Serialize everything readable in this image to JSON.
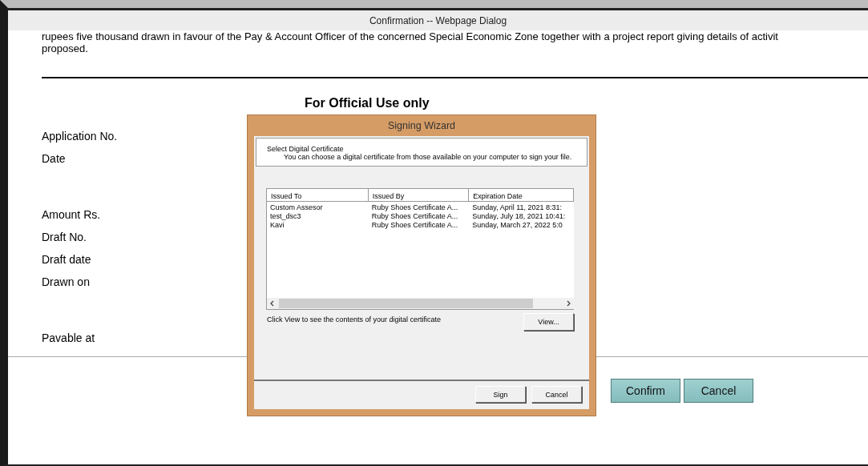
{
  "window": {
    "title": "Confirmation -- Webpage Dialog"
  },
  "page": {
    "paragraph_lines": [
      "rupees five thousand drawn in favour of the Pay & Account Officer of the concerned Special Economic Zone together with a project report giving details of activit",
      "proposed."
    ],
    "heading": "For Official Use only",
    "fields": [
      "Application No.",
      "Date",
      "Amount Rs.",
      "Draft No.",
      "Draft date",
      "Drawn on",
      "Pavable at"
    ],
    "buttons": [
      "Confirm",
      "Cancel"
    ]
  },
  "wizard": {
    "title": "Signing Wizard",
    "header_title": "Select Digital Certificate",
    "header_subtitle": "You can choose a digital certificate from those available on your computer to sign your file.",
    "columns": [
      "Issued To",
      "Issued By",
      "Expiration Date"
    ],
    "rows": [
      [
        "Custom Assesor",
        "Ruby Shoes Certificate A...",
        "Sunday, April 11, 2021 8:31:"
      ],
      [
        "test_dsc3",
        "Ruby Shoes Certificate A...",
        "Sunday, July 18, 2021 10:41:"
      ],
      [
        "Kavi",
        "Ruby Shoes Certificate A...",
        "Sunday, March 27, 2022 5:0"
      ]
    ],
    "hint": "Click View to see the contents of your digital certificate",
    "view_button": "View...",
    "buttons": [
      "Sign",
      "Cancel"
    ]
  }
}
